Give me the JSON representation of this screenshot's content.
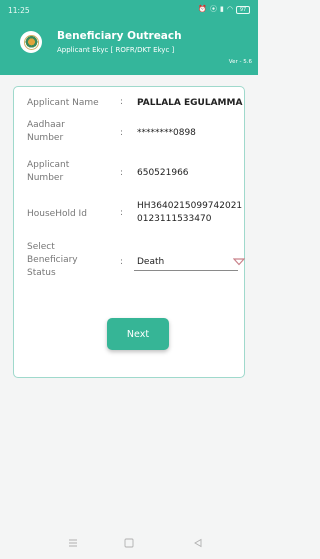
{
  "status_bar": {
    "time": "11:25",
    "icons": [
      "alarm-icon",
      "location-icon",
      "signal-icon",
      "wifi-icon",
      "battery-icon"
    ],
    "battery_label": "97"
  },
  "header": {
    "title": "Beneficiary Outreach",
    "subtitle": "Applicant Ekyc [ ROFR/DKT Ekyc ]",
    "version": "Ver - 5.6",
    "background_color": "#34b69b"
  },
  "form": {
    "applicant_name": {
      "label": "Applicant Name",
      "value": "PALLALA EGULAMMA"
    },
    "aadhaar_number": {
      "label_line1": "Aadhaar",
      "label_line2": "Number",
      "value": "********0898"
    },
    "applicant_number": {
      "label_line1": "Applicant",
      "label_line2": "Number",
      "value": "650521966"
    },
    "household_id": {
      "label": "HouseHold Id",
      "value_line1": "HH3640215099742021",
      "value_line2": "0123111533470"
    },
    "beneficiary_status": {
      "label_line1": "Select",
      "label_line2": "Beneficiary",
      "label_line3": "Status",
      "selected": "Death"
    },
    "colon": ":"
  },
  "actions": {
    "next_label": "Next",
    "accent_color": "#36b596"
  },
  "nav_bar": {
    "icons": [
      "menu-icon",
      "home-icon",
      "back-icon"
    ]
  }
}
